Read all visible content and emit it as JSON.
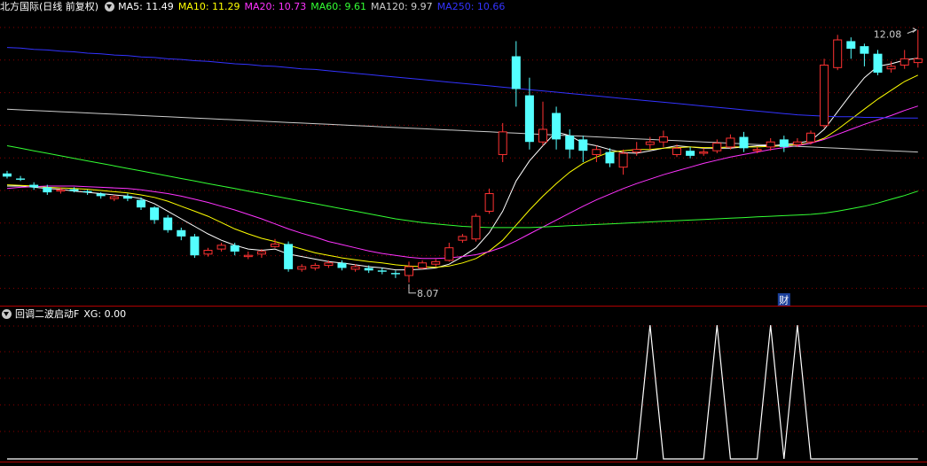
{
  "main_header": {
    "title": "北方国际(日线 前复权)",
    "ma_legend": [
      {
        "label": "MA5: 11.49",
        "color": "#ffffff"
      },
      {
        "label": "MA10: 11.29",
        "color": "#ffff00"
      },
      {
        "label": "MA20: 10.73",
        "color": "#ff33ff"
      },
      {
        "label": "MA60: 9.61",
        "color": "#33ff33"
      },
      {
        "label": "MA120: 9.97",
        "color": "#cccccc"
      },
      {
        "label": "MA250: 10.66",
        "color": "#3333ff"
      }
    ]
  },
  "indicator_header": {
    "title": "回调二波启动F",
    "value_label": "XG: 0.00"
  },
  "annotations": {
    "high_label": "12.08",
    "low_label": "8.07",
    "fin_badge": "财"
  },
  "colors": {
    "up": "#ff3232",
    "down": "#54ffff",
    "grid": "#8b0000",
    "separator": "#b00000",
    "indicator_line": "#ffffff"
  },
  "chart_data": [
    {
      "type": "candlestick",
      "title": "北方国际(日线 前复权)",
      "ylim": [
        7.8,
        12.3
      ],
      "candles": [
        [
          9.8,
          9.75,
          9.84,
          9.72
        ],
        [
          9.72,
          9.7,
          9.76,
          9.68
        ],
        [
          9.62,
          9.58,
          9.66,
          9.54
        ],
        [
          9.58,
          9.5,
          9.62,
          9.46
        ],
        [
          9.52,
          9.54,
          9.58,
          9.48
        ],
        [
          9.55,
          9.52,
          9.58,
          9.5
        ],
        [
          9.52,
          9.5,
          9.54,
          9.46
        ],
        [
          9.48,
          9.44,
          9.5,
          9.4
        ],
        [
          9.4,
          9.43,
          9.46,
          9.36
        ],
        [
          9.44,
          9.4,
          9.48,
          9.36
        ],
        [
          9.38,
          9.26,
          9.42,
          9.22
        ],
        [
          9.26,
          9.06,
          9.28,
          9.0
        ],
        [
          9.1,
          8.9,
          9.14,
          8.86
        ],
        [
          8.9,
          8.8,
          8.94,
          8.74
        ],
        [
          8.8,
          8.5,
          8.84,
          8.46
        ],
        [
          8.52,
          8.58,
          8.62,
          8.48
        ],
        [
          8.6,
          8.66,
          8.7,
          8.56
        ],
        [
          8.66,
          8.56,
          8.7,
          8.5
        ],
        [
          8.48,
          8.5,
          8.56,
          8.44
        ],
        [
          8.52,
          8.56,
          8.6,
          8.46
        ],
        [
          8.64,
          8.68,
          8.76,
          8.62
        ],
        [
          8.68,
          8.28,
          8.72,
          8.24
        ],
        [
          8.28,
          8.32,
          8.36,
          8.24
        ],
        [
          8.3,
          8.34,
          8.38,
          8.26
        ],
        [
          8.34,
          8.38,
          8.42,
          8.3
        ],
        [
          8.38,
          8.3,
          8.42,
          8.26
        ],
        [
          8.28,
          8.32,
          8.36,
          8.24
        ],
        [
          8.3,
          8.26,
          8.34,
          8.22
        ],
        [
          8.26,
          8.24,
          8.3,
          8.2
        ],
        [
          8.22,
          8.2,
          8.26,
          8.14
        ],
        [
          8.18,
          8.32,
          8.4,
          8.07
        ],
        [
          8.3,
          8.38,
          8.42,
          8.28
        ],
        [
          8.36,
          8.4,
          8.44,
          8.32
        ],
        [
          8.42,
          8.62,
          8.7,
          8.4
        ],
        [
          8.74,
          8.8,
          8.84,
          8.7
        ],
        [
          8.76,
          9.12,
          9.16,
          8.72
        ],
        [
          9.2,
          9.48,
          9.56,
          9.16
        ],
        [
          10.1,
          10.46,
          10.6,
          9.98
        ],
        [
          11.66,
          11.14,
          11.9,
          10.86
        ],
        [
          11.04,
          10.3,
          11.32,
          10.18
        ],
        [
          10.3,
          10.5,
          10.94,
          10.24
        ],
        [
          10.76,
          10.34,
          10.86,
          10.18
        ],
        [
          10.4,
          10.18,
          10.5,
          10.04
        ],
        [
          10.34,
          10.16,
          10.4,
          9.98
        ],
        [
          10.1,
          10.18,
          10.24,
          9.98
        ],
        [
          10.14,
          9.96,
          10.2,
          9.9
        ],
        [
          9.9,
          10.12,
          10.18,
          9.78
        ],
        [
          10.14,
          10.18,
          10.3,
          10.08
        ],
        [
          10.26,
          10.3,
          10.38,
          10.18
        ],
        [
          10.3,
          10.38,
          10.48,
          10.22
        ],
        [
          10.1,
          10.2,
          10.26,
          10.06
        ],
        [
          10.16,
          10.08,
          10.22,
          10.04
        ],
        [
          10.12,
          10.14,
          10.2,
          10.08
        ],
        [
          10.16,
          10.28,
          10.34,
          10.12
        ],
        [
          10.22,
          10.36,
          10.42,
          10.18
        ],
        [
          10.38,
          10.2,
          10.46,
          10.14
        ],
        [
          10.16,
          10.18,
          10.22,
          10.12
        ],
        [
          10.22,
          10.3,
          10.36,
          10.16
        ],
        [
          10.34,
          10.22,
          10.4,
          10.14
        ],
        [
          10.26,
          10.3,
          10.36,
          10.22
        ],
        [
          10.3,
          10.44,
          10.48,
          10.26
        ],
        [
          10.56,
          11.52,
          11.62,
          10.52
        ],
        [
          11.48,
          11.92,
          12.0,
          11.44
        ],
        [
          11.9,
          11.78,
          11.96,
          11.62
        ],
        [
          11.82,
          11.7,
          11.86,
          11.5
        ],
        [
          11.7,
          11.4,
          11.76,
          11.36
        ],
        [
          11.46,
          11.5,
          11.58,
          11.4
        ],
        [
          11.52,
          11.62,
          11.76,
          11.46
        ],
        [
          11.56,
          11.62,
          12.08,
          11.48
        ]
      ],
      "series": [
        {
          "name": "MA5",
          "values": [
            9.6,
            9.6,
            9.58,
            9.56,
            9.55,
            9.52,
            9.5,
            9.48,
            9.46,
            9.44,
            9.4,
            9.32,
            9.2,
            9.08,
            8.96,
            8.84,
            8.74,
            8.66,
            8.6,
            8.58,
            8.6,
            8.52,
            8.48,
            8.44,
            8.4,
            8.38,
            8.35,
            8.32,
            8.3,
            8.27,
            8.27,
            8.28,
            8.3,
            8.36,
            8.48,
            8.62,
            8.86,
            9.2,
            9.68,
            10.0,
            10.24,
            10.46,
            10.4,
            10.28,
            10.24,
            10.18,
            10.13,
            10.12,
            10.16,
            10.2,
            10.24,
            10.22,
            10.2,
            10.2,
            10.2,
            10.22,
            10.24,
            10.24,
            10.26,
            10.28,
            10.32,
            10.5,
            10.78,
            11.06,
            11.32,
            11.5,
            11.54,
            11.6,
            11.63
          ]
        },
        {
          "name": "MA10",
          "values": [
            9.62,
            9.61,
            9.6,
            9.58,
            9.57,
            9.56,
            9.55,
            9.53,
            9.51,
            9.49,
            9.46,
            9.42,
            9.36,
            9.28,
            9.2,
            9.12,
            9.02,
            8.92,
            8.84,
            8.77,
            8.72,
            8.66,
            8.6,
            8.54,
            8.5,
            8.46,
            8.43,
            8.4,
            8.38,
            8.35,
            8.33,
            8.32,
            8.31,
            8.33,
            8.38,
            8.45,
            8.57,
            8.74,
            8.98,
            9.22,
            9.44,
            9.64,
            9.82,
            9.96,
            10.06,
            10.14,
            10.16,
            10.18,
            10.18,
            10.2,
            10.21,
            10.22,
            10.21,
            10.21,
            10.22,
            10.22,
            10.22,
            10.23,
            10.24,
            10.26,
            10.28,
            10.36,
            10.5,
            10.66,
            10.82,
            10.98,
            11.12,
            11.26,
            11.36
          ]
        },
        {
          "name": "MA20",
          "values": [
            9.56,
            9.58,
            9.59,
            9.6,
            9.6,
            9.6,
            9.59,
            9.58,
            9.57,
            9.56,
            9.54,
            9.51,
            9.48,
            9.44,
            9.39,
            9.34,
            9.28,
            9.22,
            9.15,
            9.08,
            9.0,
            8.92,
            8.85,
            8.79,
            8.72,
            8.67,
            8.62,
            8.57,
            8.53,
            8.5,
            8.47,
            8.45,
            8.45,
            8.46,
            8.48,
            8.51,
            8.56,
            8.63,
            8.73,
            8.84,
            8.95,
            9.06,
            9.17,
            9.28,
            9.38,
            9.47,
            9.56,
            9.64,
            9.71,
            9.78,
            9.84,
            9.9,
            9.96,
            10.01,
            10.06,
            10.1,
            10.14,
            10.18,
            10.21,
            10.24,
            10.28,
            10.34,
            10.42,
            10.5,
            10.58,
            10.65,
            10.72,
            10.8,
            10.87
          ]
        },
        {
          "name": "MA60",
          "values": [
            10.24,
            10.2,
            10.16,
            10.12,
            10.08,
            10.04,
            10.0,
            9.96,
            9.92,
            9.88,
            9.84,
            9.8,
            9.76,
            9.72,
            9.68,
            9.64,
            9.6,
            9.56,
            9.52,
            9.48,
            9.44,
            9.4,
            9.36,
            9.32,
            9.28,
            9.24,
            9.2,
            9.16,
            9.12,
            9.08,
            9.05,
            9.02,
            9.0,
            8.98,
            8.96,
            8.95,
            8.94,
            8.94,
            8.94,
            8.94,
            8.95,
            8.96,
            8.97,
            8.98,
            8.99,
            9.0,
            9.01,
            9.02,
            9.03,
            9.04,
            9.05,
            9.06,
            9.07,
            9.08,
            9.09,
            9.1,
            9.11,
            9.12,
            9.13,
            9.14,
            9.15,
            9.17,
            9.2,
            9.24,
            9.28,
            9.33,
            9.39,
            9.45,
            9.52
          ]
        },
        {
          "name": "MA120",
          "values": [
            10.82,
            10.81,
            10.8,
            10.79,
            10.78,
            10.77,
            10.76,
            10.75,
            10.74,
            10.73,
            10.72,
            10.71,
            10.7,
            10.69,
            10.68,
            10.67,
            10.66,
            10.65,
            10.64,
            10.63,
            10.62,
            10.61,
            10.6,
            10.59,
            10.58,
            10.57,
            10.56,
            10.55,
            10.54,
            10.53,
            10.52,
            10.51,
            10.5,
            10.49,
            10.48,
            10.47,
            10.46,
            10.45,
            10.44,
            10.43,
            10.42,
            10.41,
            10.4,
            10.39,
            10.38,
            10.37,
            10.36,
            10.35,
            10.34,
            10.33,
            10.32,
            10.31,
            10.3,
            10.29,
            10.28,
            10.27,
            10.26,
            10.25,
            10.24,
            10.23,
            10.22,
            10.21,
            10.2,
            10.19,
            10.18,
            10.17,
            10.16,
            10.15,
            10.14
          ]
        },
        {
          "name": "MA250",
          "values": [
            11.8,
            11.79,
            11.77,
            11.76,
            11.74,
            11.73,
            11.71,
            11.7,
            11.68,
            11.67,
            11.65,
            11.64,
            11.62,
            11.61,
            11.59,
            11.58,
            11.56,
            11.54,
            11.53,
            11.51,
            11.5,
            11.48,
            11.46,
            11.45,
            11.43,
            11.41,
            11.39,
            11.37,
            11.35,
            11.33,
            11.31,
            11.29,
            11.27,
            11.25,
            11.23,
            11.21,
            11.19,
            11.17,
            11.15,
            11.13,
            11.11,
            11.09,
            11.07,
            11.05,
            11.03,
            11.01,
            10.99,
            10.97,
            10.95,
            10.93,
            10.91,
            10.89,
            10.87,
            10.85,
            10.83,
            10.81,
            10.79,
            10.77,
            10.75,
            10.73,
            10.72,
            10.71,
            10.7,
            10.7,
            10.69,
            10.69,
            10.68,
            10.68,
            10.68
          ]
        }
      ],
      "high_marker": {
        "index": 68,
        "value": 12.08
      },
      "low_marker": {
        "index": 30,
        "value": 8.07
      },
      "fin_marker_index": 58
    },
    {
      "type": "line",
      "title": "回调二波启动F",
      "series": [
        {
          "name": "XG",
          "values": [
            0,
            0,
            0,
            0,
            0,
            0,
            0,
            0,
            0,
            0,
            0,
            0,
            0,
            0,
            0,
            0,
            0,
            0,
            0,
            0,
            0,
            0,
            0,
            0,
            0,
            0,
            0,
            0,
            0,
            0,
            0,
            0,
            0,
            0,
            0,
            0,
            0,
            0,
            0,
            0,
            0,
            0,
            0,
            0,
            0,
            0,
            0,
            0,
            1,
            0,
            0,
            0,
            0,
            1,
            0,
            0,
            0,
            1,
            0,
            1,
            0,
            0,
            0,
            0,
            0,
            0,
            0,
            0,
            0
          ]
        }
      ],
      "ylim": [
        0,
        1
      ]
    }
  ]
}
